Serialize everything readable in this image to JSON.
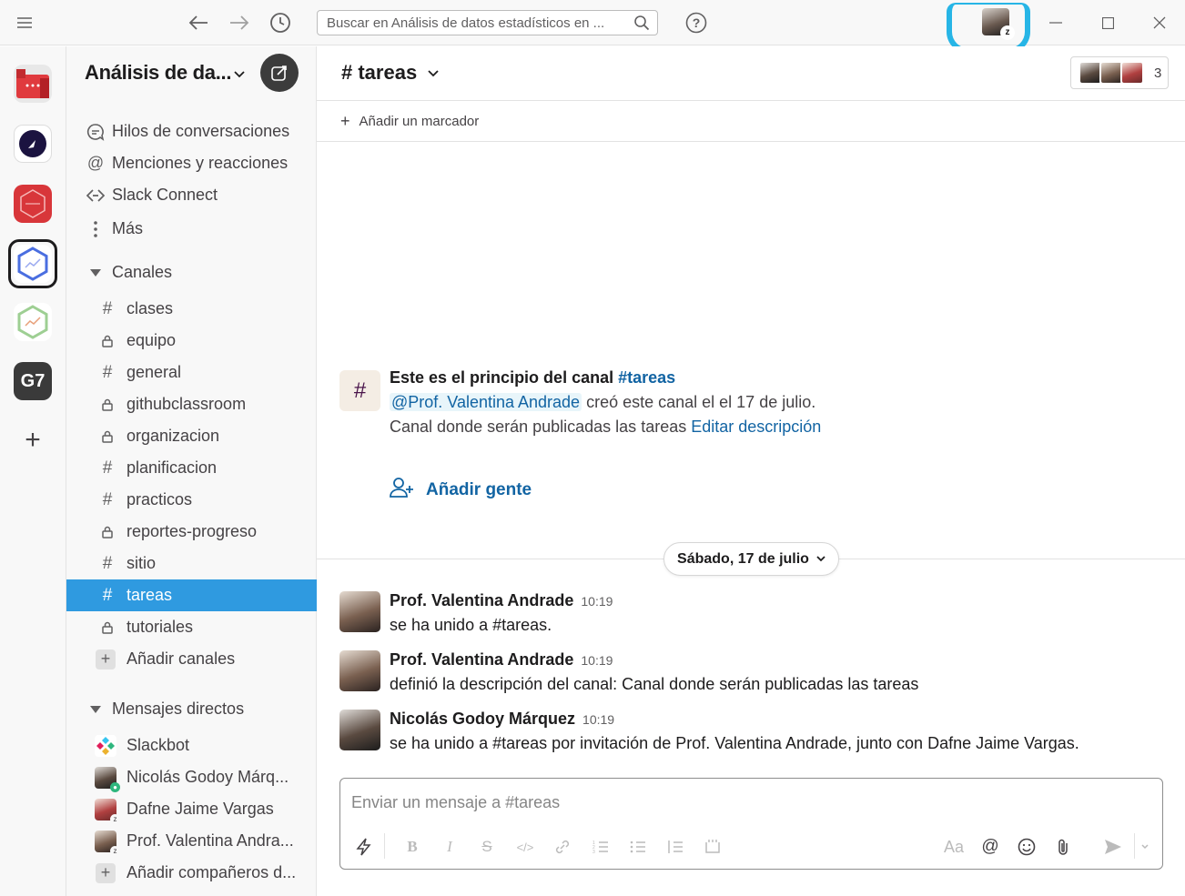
{
  "titlebar": {
    "search_placeholder": "Buscar en Análisis de datos estadísticos en ...",
    "icons": [
      "hamburger-icon",
      "back-arrow-icon",
      "forward-arrow-icon",
      "history-icon",
      "search-icon",
      "help-icon",
      "minimize-icon",
      "maximize-icon",
      "close-icon"
    ]
  },
  "rail": {
    "workspace_g7": "G7",
    "add_label": "+"
  },
  "workspace": {
    "name": "Análisis de da..."
  },
  "sidebar": {
    "nav": [
      {
        "label": "Hilos de conversaciones",
        "icon": "threads-icon"
      },
      {
        "label": "Menciones y reacciones",
        "icon": "at-icon"
      },
      {
        "label": "Slack Connect",
        "icon": "connect-icon"
      },
      {
        "label": "Más",
        "icon": "more-icon"
      }
    ],
    "channels_header": "Canales",
    "channels": [
      {
        "name": "clases",
        "private": false
      },
      {
        "name": "equipo",
        "private": true
      },
      {
        "name": "general",
        "private": false
      },
      {
        "name": "githubclassroom",
        "private": true
      },
      {
        "name": "organizacion",
        "private": true
      },
      {
        "name": "planificacion",
        "private": false
      },
      {
        "name": "practicos",
        "private": false
      },
      {
        "name": "reportes-progreso",
        "private": true
      },
      {
        "name": "sitio",
        "private": false
      },
      {
        "name": "tareas",
        "private": false,
        "active": true
      },
      {
        "name": "tutoriales",
        "private": true
      }
    ],
    "add_channels": "Añadir canales",
    "dm_header": "Mensajes directos",
    "dms": [
      {
        "name": "Slackbot"
      },
      {
        "name": "Nicolás Godoy Márq..."
      },
      {
        "name": "Dafne Jaime Vargas"
      },
      {
        "name": "Prof. Valentina Andra..."
      }
    ],
    "add_teammates": "Añadir compañeros d..."
  },
  "channel": {
    "title": "# tareas",
    "member_count": "3",
    "add_bookmark": "Añadir un marcador",
    "intro_prefix": "Este es el principio del canal ",
    "intro_channel": "#tareas",
    "creator_mention": "@Prof. Valentina Andrade",
    "created_text": " creó este canal el el 17 de julio.",
    "description_text": "Canal donde serán publicadas las tareas ",
    "edit_description": "Editar descripción",
    "add_people": "Añadir gente",
    "date_divider": "Sábado, 17 de julio"
  },
  "messages": [
    {
      "author": "Prof. Valentina Andrade",
      "time": "10:19",
      "text": "se ha unido a #tareas."
    },
    {
      "author": "Prof. Valentina Andrade",
      "time": "10:19",
      "text": "definió la descripción del canal: Canal donde serán publicadas las tareas"
    },
    {
      "author": "Nicolás Godoy Márquez",
      "time": "10:19",
      "text": "se ha unido a #tareas por invitación de Prof. Valentina Andrade, junto con Dafne Jaime Vargas."
    }
  ],
  "composer": {
    "placeholder": "Enviar un mensaje a #tareas",
    "aa_label": "Aa"
  },
  "colors": {
    "active_channel": "#2f9ae0",
    "link": "#1264a3",
    "highlight": "#27b5e6"
  }
}
